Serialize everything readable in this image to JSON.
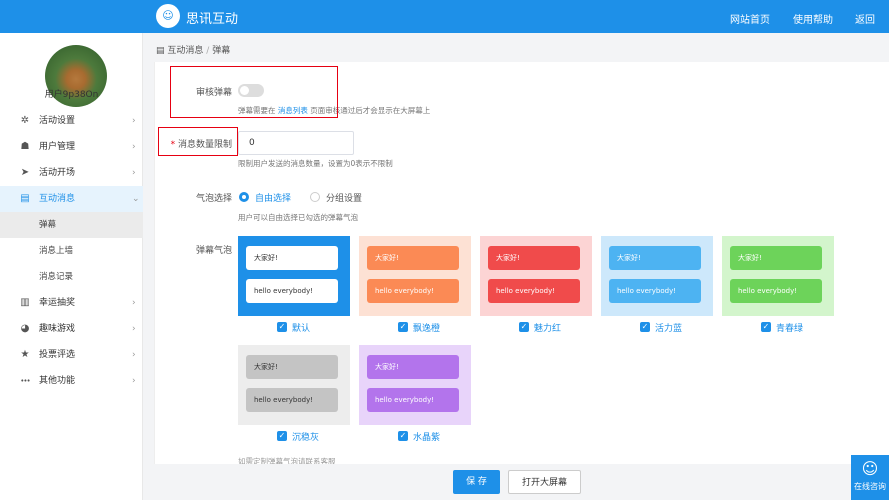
{
  "app": {
    "title": "思讯互动",
    "logo_glyph": "☺"
  },
  "topnav": [
    "网站首页",
    "使用帮助",
    "返回"
  ],
  "user": {
    "name": "用户9p38On"
  },
  "sidebar": {
    "items": [
      {
        "label": "活动设置",
        "icon": "gear-icon",
        "glyph": "✲"
      },
      {
        "label": "用户管理",
        "icon": "users-icon",
        "glyph": "☗"
      },
      {
        "label": "活动开场",
        "icon": "send-icon",
        "glyph": "➤"
      },
      {
        "label": "互动消息",
        "icon": "message-icon",
        "glyph": "▤"
      },
      {
        "label": "幸运抽奖",
        "icon": "lottery-icon",
        "glyph": "▥"
      },
      {
        "label": "趣味游戏",
        "icon": "game-icon",
        "glyph": "◕"
      },
      {
        "label": "投票评选",
        "icon": "star-icon",
        "glyph": "★"
      },
      {
        "label": "其他功能",
        "icon": "more-icon",
        "glyph": "•••"
      }
    ],
    "sub_items": [
      "弹幕",
      "消息上墙",
      "消息记录"
    ]
  },
  "breadcrumb": {
    "glyph": "▤",
    "parent": "互动消息",
    "sep": "/",
    "current": "弹幕"
  },
  "form": {
    "review": {
      "label": "审核弹幕",
      "on": false,
      "help_prefix": "弹幕需要在",
      "help_link": "消息列表",
      "help_suffix": "页面审核通过后才会显示在大屏幕上"
    },
    "limit": {
      "required_mark": "*",
      "label": "消息数量限制",
      "value": "0",
      "help": "限制用户发送的消息数量，设置为0表示不限制"
    },
    "bubble_select": {
      "label": "气泡选择",
      "options": [
        "自由选择",
        "分组设置"
      ],
      "selected": "自由选择",
      "help": "用户可以自由选择已勾选的弹幕气泡"
    },
    "bubble_label": "弹幕气泡",
    "bubbles": [
      {
        "name": "默认",
        "line1": "大家好!",
        "line2": "hello everybody!",
        "bg": "#1e90e8",
        "bubble": "#ffffff",
        "text": "#333333",
        "checked": true
      },
      {
        "name": "飘逸橙",
        "line1": "大家好!",
        "line2": "hello everybody!",
        "bg": "#fde1d4",
        "bubble": "#fb8a55",
        "text": "#ffffff",
        "checked": true
      },
      {
        "name": "魅力红",
        "line1": "大家好!",
        "line2": "hello everybody!",
        "bg": "#fcd4d4",
        "bubble": "#f04b4b",
        "text": "#ffffff",
        "checked": true
      },
      {
        "name": "活力蓝",
        "line1": "大家好!",
        "line2": "hello everybody!",
        "bg": "#cde8fb",
        "bubble": "#4db3f2",
        "text": "#ffffff",
        "checked": true
      },
      {
        "name": "青春绿",
        "line1": "大家好!",
        "line2": "hello everybody!",
        "bg": "#d3f5cc",
        "bubble": "#6dd35a",
        "text": "#ffffff",
        "checked": true
      },
      {
        "name": "沉稳灰",
        "line1": "大家好!",
        "line2": "hello everybody!",
        "bg": "#ededed",
        "bubble": "#c4c4c4",
        "text": "#333333",
        "checked": true
      },
      {
        "name": "水晶紫",
        "line1": "大家好!",
        "line2": "hello everybody!",
        "bg": "#e8d4fa",
        "bubble": "#b374ec",
        "text": "#ffffff",
        "checked": true
      }
    ],
    "footer_note": "如需定制弹幕气泡请联系客服"
  },
  "buttons": {
    "save": "保 存",
    "open": "打开大屏幕"
  },
  "online": {
    "label": "在线咨询",
    "glyph": "☺"
  },
  "colors": {
    "primary": "#1e90e8",
    "highlight": "#e60012"
  }
}
